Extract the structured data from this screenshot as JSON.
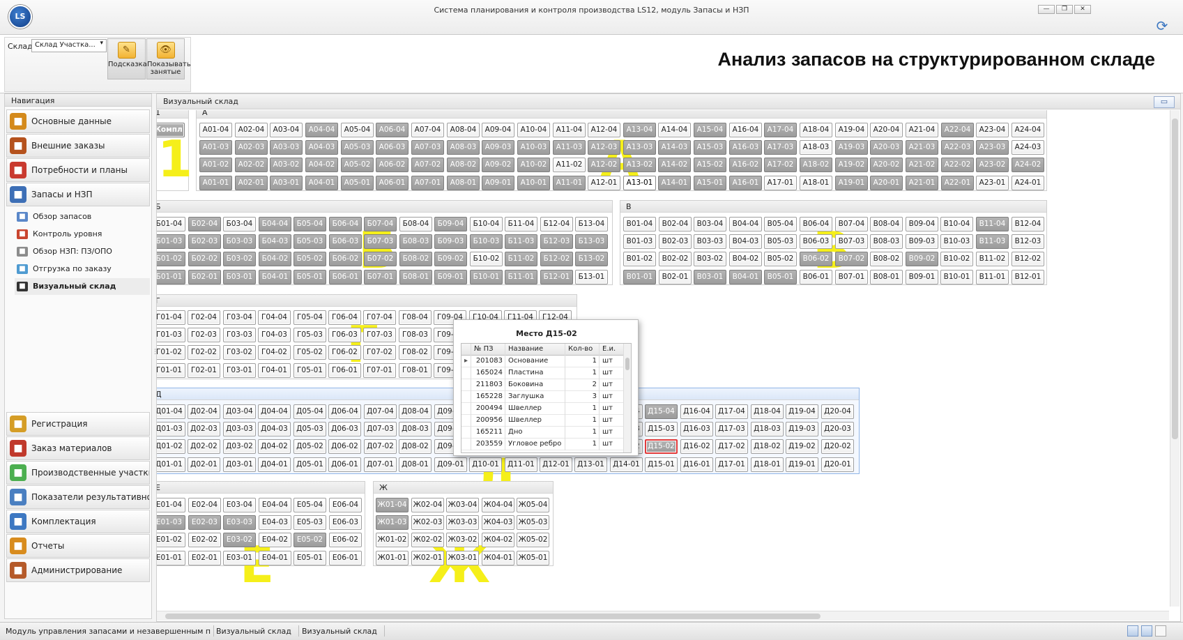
{
  "window": {
    "title": "Система планирования и контроля производства LS12, модуль Запасы и НЗП",
    "logo_text": "LS",
    "controls": [
      "minimize",
      "restore",
      "close"
    ]
  },
  "ribbon": {
    "store_label": "Склад",
    "store_value": "Склад Участка...",
    "hint_label": "Подсказка",
    "show_occupied_label": "Показывать занятые",
    "page_title": "Анализ запасов на структурированном складе"
  },
  "nav": {
    "header": "Навигация",
    "top_items": [
      {
        "label": "Основные данные",
        "icon": "gear-icon",
        "color": "#d48a1c"
      },
      {
        "label": "Внешние заказы",
        "icon": "briefcase-icon",
        "color": "#b5521d"
      },
      {
        "label": "Потребности и планы",
        "icon": "clock-icon",
        "color": "#c93a2f"
      },
      {
        "label": "Запасы и НЗП",
        "icon": "bar-chart-icon",
        "color": "#3d6fb6"
      }
    ],
    "sub_items": [
      {
        "label": "Обзор запасов",
        "icon": "chart-icon",
        "color": "#5a87c9"
      },
      {
        "label": "Контроль уровня",
        "icon": "level-icon",
        "color": "#c9452f"
      },
      {
        "label": "Обзор НЗП: ПЗ/ОПО",
        "icon": "document-icon",
        "color": "#8c8c8c"
      },
      {
        "label": "Отгрузка по заказу",
        "icon": "shipment-icon",
        "color": "#4f9bd1"
      },
      {
        "label": "Визуальный склад",
        "icon": "grid-icon",
        "color": "#333333",
        "active": true
      }
    ],
    "bottom_items": [
      {
        "label": "Регистрация",
        "icon": "checklist-icon",
        "color": "#d59d26"
      },
      {
        "label": "Заказ материалов",
        "icon": "books-icon",
        "color": "#c0392b"
      },
      {
        "label": "Производственные участки",
        "icon": "puzzle-icon",
        "color": "#4caf50"
      },
      {
        "label": "Показатели результативности",
        "icon": "trend-chart-icon",
        "color": "#4a7fc1"
      },
      {
        "label": "Комплектация",
        "icon": "structure-icon",
        "color": "#3d78c2"
      },
      {
        "label": "Отчеты",
        "icon": "report-icon",
        "color": "#d88c1e"
      },
      {
        "label": "Администрирование",
        "icon": "users-icon",
        "color": "#b55a2a"
      }
    ]
  },
  "main": {
    "header": "Визуальный склад",
    "zones": [
      {
        "id": "z1",
        "name": "1",
        "watermark": "1",
        "special": "Компл"
      },
      {
        "id": "zA",
        "name": "А",
        "watermark": "А",
        "prefix": "А",
        "cols": 24,
        "levels": [
          "04",
          "03",
          "02",
          "01"
        ],
        "occupied": {
          "04": [
            4,
            6,
            13,
            15,
            17,
            22
          ],
          "03": [
            1,
            2,
            3,
            4,
            5,
            6,
            7,
            8,
            9,
            10,
            11,
            12,
            13,
            14,
            15,
            16,
            17,
            19,
            20,
            21,
            22,
            23
          ],
          "02": [
            1,
            2,
            3,
            4,
            5,
            6,
            7,
            8,
            9,
            10,
            12,
            13,
            14,
            15,
            16,
            17,
            18,
            19,
            20,
            21,
            22,
            23,
            24
          ],
          "01": [
            1,
            2,
            3,
            4,
            5,
            6,
            7,
            8,
            9,
            10,
            11,
            14,
            15,
            16,
            19,
            20,
            21,
            22
          ]
        },
        "highlight": {
          "01": [
            13
          ]
        },
        "yellow": {
          "01": [
            12
          ],
          "03": [
            12
          ],
          "02": [
            12
          ]
        }
      },
      {
        "id": "zB",
        "name": "Б",
        "watermark": "Б",
        "prefix": "Б",
        "cols": 13,
        "levels": [
          "04",
          "03",
          "02",
          "01"
        ],
        "occupied": {
          "04": [
            2,
            4,
            5,
            6,
            7,
            9
          ],
          "03": [
            1,
            2,
            3,
            4,
            5,
            6,
            7,
            8,
            9,
            10,
            11,
            12,
            13
          ],
          "02": [
            1,
            2,
            3,
            4,
            5,
            6,
            7,
            8,
            9,
            11,
            12,
            13
          ],
          "01": [
            1,
            2,
            3,
            4,
            5,
            6,
            7,
            8,
            9,
            10,
            11,
            12
          ]
        },
        "highlight": {},
        "yellow": {
          "03": [
            7
          ],
          "02": [
            7
          ],
          "01": [
            7
          ]
        }
      },
      {
        "id": "zV",
        "name": "В",
        "watermark": "В",
        "prefix": "В",
        "cols": 12,
        "levels": [
          "04",
          "03",
          "02",
          "01"
        ],
        "occupied": {
          "04": [
            11
          ],
          "03": [
            11
          ],
          "02": [
            6,
            7,
            9
          ],
          "01": [
            1,
            3,
            4,
            5
          ]
        },
        "highlight": {},
        "yellow": {
          "03": [
            6,
            7
          ],
          "02": []
        }
      },
      {
        "id": "zG",
        "name": "Г",
        "watermark": "Г",
        "prefix": "Г",
        "cols": 12,
        "levels": [
          "04",
          "03",
          "02",
          "01"
        ],
        "occupied": {},
        "highlight": {},
        "yellow": {
          "03": [
            6
          ],
          "02": [
            6
          ],
          "01": [
            6
          ]
        }
      },
      {
        "id": "zD",
        "name": "Д",
        "watermark": "Д",
        "prefix": "Д",
        "cols": 20,
        "levels": [
          "04",
          "03",
          "02",
          "01"
        ],
        "occupied": {
          "04": [
            15
          ],
          "02": [
            15
          ]
        },
        "highlight": {},
        "yellow": {},
        "selected": {
          "02": [
            15
          ]
        }
      },
      {
        "id": "zE",
        "name": "Е",
        "watermark": "Е",
        "prefix": "Е",
        "cols": 6,
        "levels": [
          "04",
          "03",
          "02",
          "01"
        ],
        "occupied": {
          "03": [
            1,
            2,
            3
          ],
          "02": [
            3,
            5
          ]
        },
        "highlight": {},
        "yellow": {
          "03": [
            3
          ],
          "01": [
            3
          ]
        }
      },
      {
        "id": "zZh",
        "name": "Ж",
        "watermark": "Ж",
        "prefix": "Ж",
        "cols": 5,
        "levels": [
          "04",
          "03",
          "02",
          "01"
        ],
        "occupied": {
          "04": [
            1
          ],
          "03": [
            1
          ]
        },
        "highlight": {},
        "yellow": {
          "03": [
            3
          ],
          "02": [
            3
          ],
          "01": [
            3
          ]
        }
      }
    ]
  },
  "popup": {
    "title": "Место Д15-02",
    "columns": [
      "№ ПЗ",
      "Название",
      "Кол-во",
      "Е.и."
    ],
    "rows": [
      {
        "num": "201083",
        "name": "Основание",
        "qty": "1",
        "unit": "шт",
        "current": true
      },
      {
        "num": "165024",
        "name": "Пластина",
        "qty": "1",
        "unit": "шт"
      },
      {
        "num": "211803",
        "name": "Боковина",
        "qty": "2",
        "unit": "шт"
      },
      {
        "num": "165228",
        "name": "Заглушка",
        "qty": "3",
        "unit": "шт"
      },
      {
        "num": "200494",
        "name": "Швеллер",
        "qty": "1",
        "unit": "шт"
      },
      {
        "num": "200956",
        "name": "Швеллер",
        "qty": "1",
        "unit": "шт"
      },
      {
        "num": "165211",
        "name": "Дно",
        "qty": "1",
        "unit": "шт"
      },
      {
        "num": "203559",
        "name": "Угловое ребро",
        "qty": "1",
        "unit": "шт"
      }
    ]
  },
  "status": {
    "module": "Модуль управления запасами и незавершенным производством",
    "view1": "Визуальный склад",
    "view2": "Визуальный склад"
  }
}
